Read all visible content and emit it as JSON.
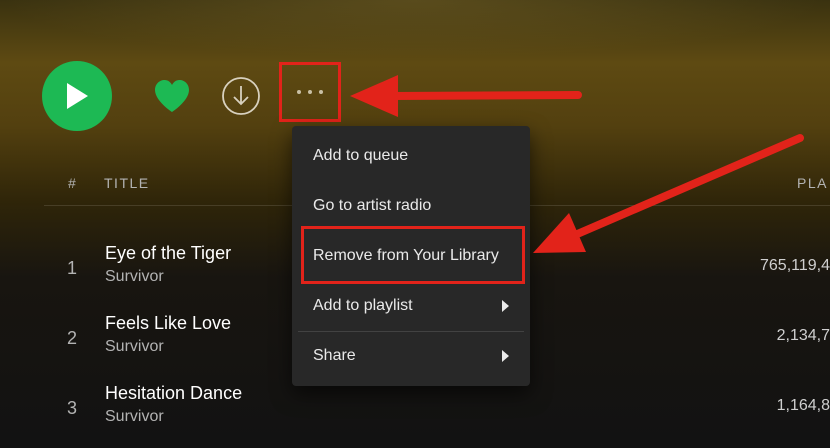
{
  "controls": {
    "play_icon": "play-icon",
    "like_icon": "heart-icon",
    "download_icon": "download-icon",
    "more_icon": "more-options-icon"
  },
  "table_header": {
    "number": "#",
    "title": "TITLE",
    "plays": "PLA"
  },
  "tracks": [
    {
      "number": "1",
      "title": "Eye of the Tiger",
      "artist": "Survivor",
      "plays": "765,119,4"
    },
    {
      "number": "2",
      "title": "Feels Like Love",
      "artist": "Survivor",
      "plays": "2,134,7"
    },
    {
      "number": "3",
      "title": "Hesitation Dance",
      "artist": "Survivor",
      "plays": "1,164,8"
    }
  ],
  "context_menu": {
    "items": [
      {
        "label": "Add to queue"
      },
      {
        "label": "Go to artist radio"
      },
      {
        "label": "Remove from Your Library"
      },
      {
        "label": "Add to playlist"
      },
      {
        "label": "Share"
      }
    ]
  },
  "colors": {
    "accent": "#1db954",
    "annotation": "#e2231a",
    "menu_bg": "#282828"
  }
}
